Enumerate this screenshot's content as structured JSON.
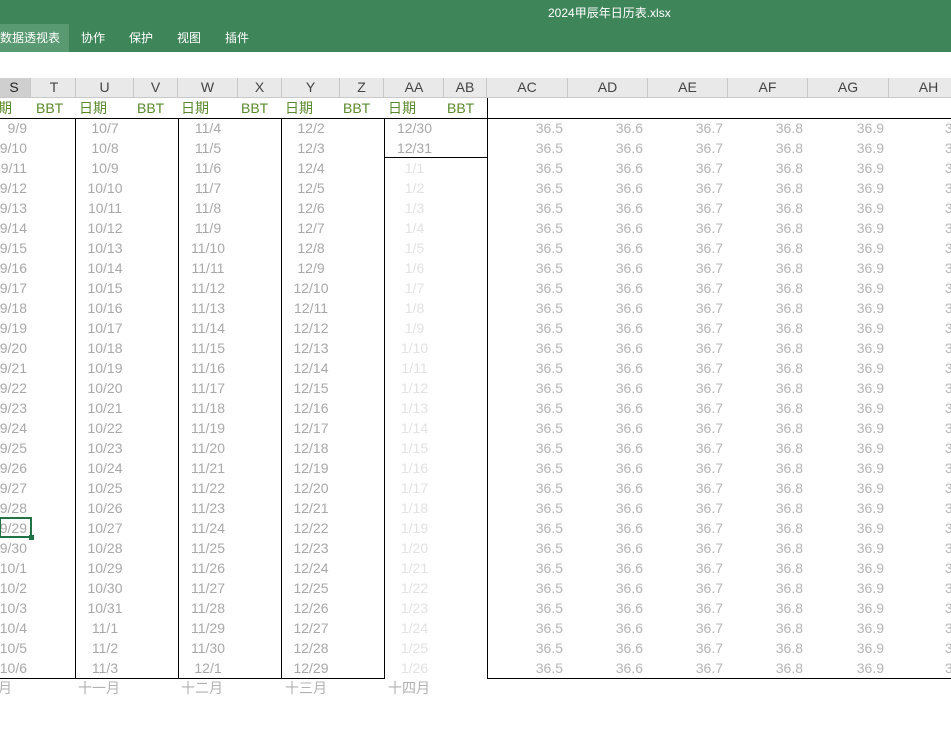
{
  "window": {
    "title": "2024甲辰年日历表.xlsx"
  },
  "ribbon": {
    "tabs": [
      "数据透视表",
      "协作",
      "保护",
      "视图",
      "插件"
    ],
    "active_tab": "数据透视表"
  },
  "columns": [
    "S",
    "T",
    "U",
    "V",
    "W",
    "X",
    "Y",
    "Z",
    "AA",
    "AB",
    "AC",
    "AD",
    "AE",
    "AF",
    "AG",
    "AH"
  ],
  "selected_column": "S",
  "header_row": {
    "date_label_partial": "期",
    "date_label": "日期",
    "bbt_label": "BBT"
  },
  "date_columns": {
    "S": [
      "9/9",
      "9/10",
      "9/11",
      "9/12",
      "9/13",
      "9/14",
      "9/15",
      "9/16",
      "9/17",
      "9/18",
      "9/19",
      "9/20",
      "9/21",
      "9/22",
      "9/23",
      "9/24",
      "9/25",
      "9/26",
      "9/27",
      "9/28",
      "9/29",
      "9/30",
      "10/1",
      "10/2",
      "10/3",
      "10/4",
      "10/5",
      "10/6"
    ],
    "U": [
      "10/7",
      "10/8",
      "10/9",
      "10/10",
      "10/11",
      "10/12",
      "10/13",
      "10/14",
      "10/15",
      "10/16",
      "10/17",
      "10/18",
      "10/19",
      "10/20",
      "10/21",
      "10/22",
      "10/23",
      "10/24",
      "10/25",
      "10/26",
      "10/27",
      "10/28",
      "10/29",
      "10/30",
      "10/31",
      "11/1",
      "11/2",
      "11/3"
    ],
    "W": [
      "11/4",
      "11/5",
      "11/6",
      "11/7",
      "11/8",
      "11/9",
      "11/10",
      "11/11",
      "11/12",
      "11/13",
      "11/14",
      "11/15",
      "11/16",
      "11/17",
      "11/18",
      "11/19",
      "11/20",
      "11/21",
      "11/22",
      "11/23",
      "11/24",
      "11/25",
      "11/26",
      "11/27",
      "11/28",
      "11/29",
      "11/30",
      "12/1"
    ],
    "Y": [
      "12/2",
      "12/3",
      "12/4",
      "12/5",
      "12/6",
      "12/7",
      "12/8",
      "12/9",
      "12/10",
      "12/11",
      "12/12",
      "12/13",
      "12/14",
      "12/15",
      "12/16",
      "12/17",
      "12/18",
      "12/19",
      "12/20",
      "12/21",
      "12/22",
      "12/23",
      "12/24",
      "12/25",
      "12/26",
      "12/27",
      "12/28",
      "12/29"
    ],
    "AA": [
      "12/30",
      "12/31",
      "1/1",
      "1/2",
      "1/3",
      "1/4",
      "1/5",
      "1/6",
      "1/7",
      "1/8",
      "1/9",
      "1/10",
      "1/11",
      "1/12",
      "1/13",
      "1/14",
      "1/15",
      "1/16",
      "1/17",
      "1/18",
      "1/19",
      "1/20",
      "1/21",
      "1/22",
      "1/23",
      "1/24",
      "1/25",
      "1/26"
    ]
  },
  "temp_scale": {
    "AC": "36.5",
    "AD": "36.6",
    "AE": "36.7",
    "AF": "36.8",
    "AG": "36.9"
  },
  "row_count": 28,
  "month_labels": {
    "S": "月",
    "U": "十一月",
    "W": "十二月",
    "Y": "十三月",
    "AA": "十四月"
  },
  "selected_cell_value": "9/29",
  "colors": {
    "ribbon": "#3f855a",
    "header_text": "#5a8a2a",
    "selection": "#217346"
  }
}
